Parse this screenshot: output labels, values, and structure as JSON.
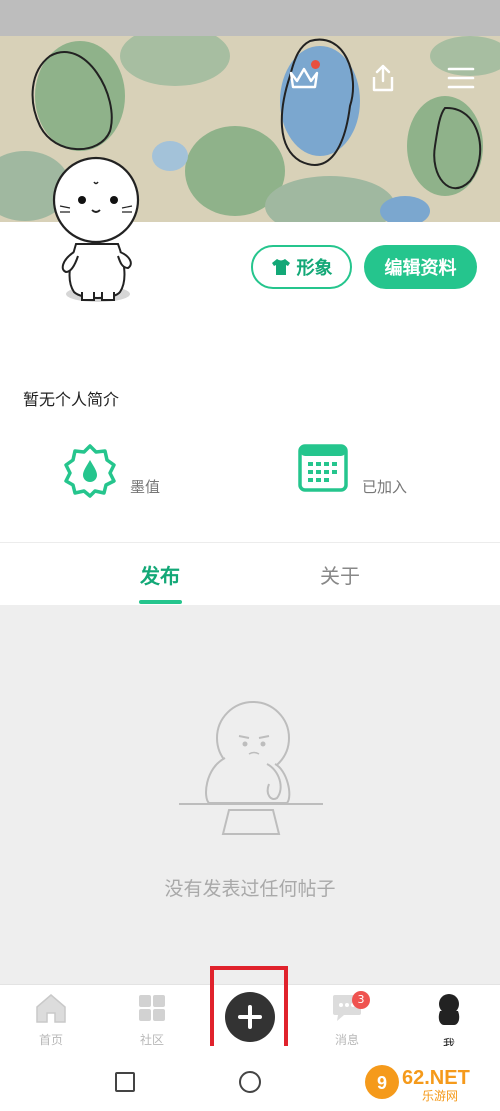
{
  "header": {
    "icons": [
      "crown-icon",
      "share-icon",
      "menu-icon"
    ]
  },
  "profile": {
    "avatar_label": "seal-avatar",
    "outfit_button": "形象",
    "edit_button": "编辑资料",
    "bio": "暂无个人简介"
  },
  "stats": {
    "ink_label": "墨值",
    "joined_label": "已加入"
  },
  "tabs": [
    {
      "label": "发布",
      "active": true
    },
    {
      "label": "关于",
      "active": false
    }
  ],
  "empty_state": {
    "message": "没有发表过任何帖子"
  },
  "bottom_nav": {
    "items": [
      {
        "label": "首页",
        "icon": "home-icon"
      },
      {
        "label": "社区",
        "icon": "community-icon"
      },
      {
        "label": "消息",
        "icon": "message-icon",
        "badge": "3"
      },
      {
        "label": "我",
        "icon": "me-icon"
      }
    ],
    "add_icon": "plus-icon"
  },
  "watermark": {
    "brand": "962.NET",
    "site": "乐游网"
  },
  "colors": {
    "accent": "#25c58d",
    "accent_dark": "#13a877",
    "badge": "#ef5350",
    "highlight": "#e0222c"
  }
}
